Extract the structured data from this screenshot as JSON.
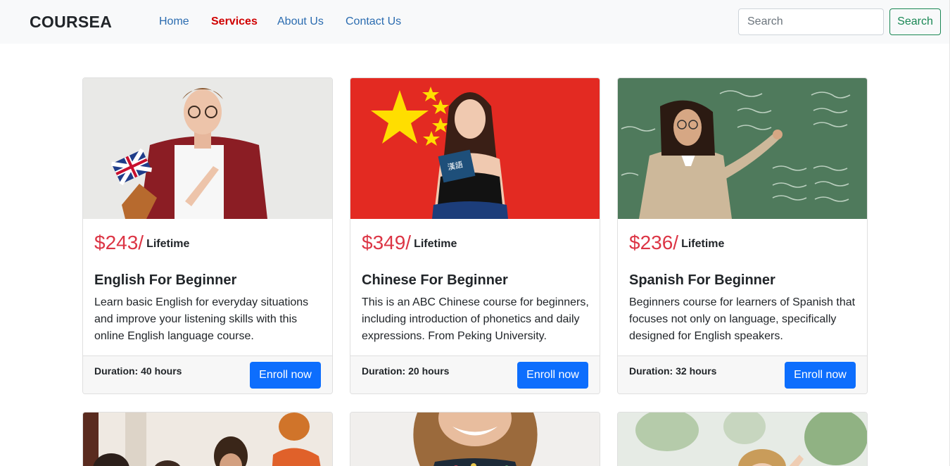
{
  "brand": "COURSEA",
  "nav": {
    "home": "Home",
    "services": "Services",
    "about": "About Us",
    "contact": "Contact Us"
  },
  "search": {
    "placeholder": "Search",
    "button": "Search"
  },
  "courses": [
    {
      "price": "$243/",
      "price_term": "Lifetime",
      "title": "English For Beginner",
      "description": "Learn basic English for everyday situations and improve your listening skills with this online English language course.",
      "duration": "Duration: 40 hours",
      "cta": "Enroll now"
    },
    {
      "price": "$349/",
      "price_term": "Lifetime",
      "title": "Chinese For Beginner",
      "description": "This is an ABC Chinese course for beginners, including introduction of phonetics and daily expressions. From Peking University.",
      "duration": "Duration: 20 hours",
      "cta": "Enroll now"
    },
    {
      "price": "$236/",
      "price_term": "Lifetime",
      "title": "Spanish For Beginner",
      "description": "Beginners course for learners of Spanish that focuses not only on language, specifically designed for English speakers.",
      "duration": "Duration: 32 hours",
      "cta": "Enroll now"
    }
  ],
  "colors": {
    "price": "#dc3545",
    "primary": "#0d6efd",
    "success": "#198754",
    "nav_active": "#d00000",
    "nav_link": "#2b6cb0"
  }
}
